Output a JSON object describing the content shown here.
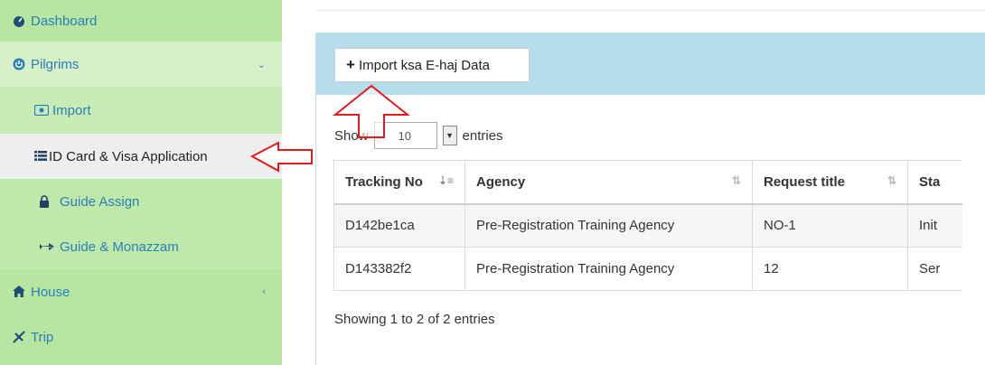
{
  "sidebar": {
    "items": [
      {
        "label": "Dashboard",
        "icon": "dashboard-icon"
      },
      {
        "label": "Pilgrims",
        "icon": "power-icon",
        "chevron": "⌄"
      },
      {
        "label": "Import",
        "icon": "import-icon"
      },
      {
        "label": "ID Card & Visa Application",
        "icon": "list-icon"
      },
      {
        "label": "Guide Assign",
        "icon": "user-lock-icon"
      },
      {
        "label": "Guide & Monazzam",
        "icon": "plane-icon"
      },
      {
        "label": "House",
        "icon": "home-icon",
        "chevron": "‹"
      },
      {
        "label": "Trip",
        "icon": "trip-icon"
      }
    ]
  },
  "panel": {
    "import_button": "Import ksa E-haj Data",
    "show_label": "Show",
    "entries_value": "10",
    "entries_label": "entries",
    "columns": [
      "Tracking No",
      "Agency",
      "Request title",
      "Sta"
    ],
    "rows": [
      [
        "D142be1ca",
        "Pre-Registration Training Agency",
        "NO-1",
        "Init"
      ],
      [
        "D143382f2",
        "Pre-Registration Training Agency",
        "12",
        "Ser"
      ]
    ],
    "info": "Showing 1 to 2 of 2 entries"
  },
  "colors": {
    "sidebar_bg": "#b6e6a2",
    "panel_head_bg": "#b7dcec",
    "link": "#2a7fb8",
    "annotation": "#e11b1b"
  }
}
